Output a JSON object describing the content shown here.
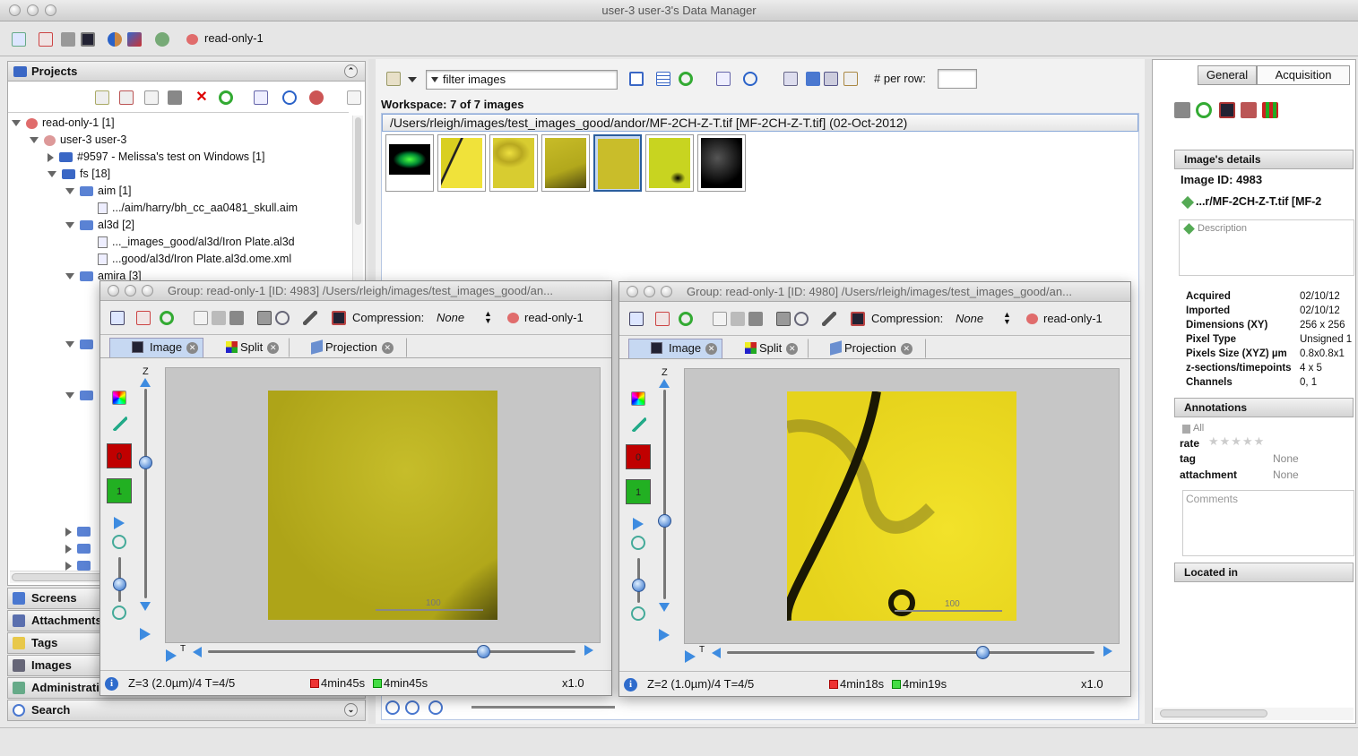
{
  "window": {
    "title": "user-3 user-3's Data Manager"
  },
  "toolbar": {
    "group_label": "read-only-1"
  },
  "projects": {
    "header": "Projects",
    "tree": [
      {
        "label": "read-only-1 [1]"
      },
      {
        "label": "user-3 user-3"
      },
      {
        "label": "#9597 - Melissa's test on Windows [1]"
      },
      {
        "label": "fs [18]"
      },
      {
        "label": "aim [1]"
      },
      {
        "label": ".../aim/harry/bh_cc_aa0481_skull.aim"
      },
      {
        "label": "al3d [2]"
      },
      {
        "label": "..._images_good/al3d/Iron Plate.al3d"
      },
      {
        "label": "...good/al3d/Iron Plate.al3d.ome.xml"
      },
      {
        "label": "amira [3]"
      }
    ]
  },
  "accordion": [
    "Screens",
    "Attachments",
    "Tags",
    "Images",
    "Administration",
    "Search"
  ],
  "center": {
    "filter_placeholder": "filter  images",
    "per_row_label": "# per row:",
    "workspace": "Workspace: 7 of 7 images",
    "path": "/Users/rleigh/images/test_images_good/andor/MF-2CH-Z-T.tif [MF-2CH-Z-T.tif] (02-Oct-2012)"
  },
  "viewer1": {
    "title": "Group: read-only-1 [ID: 4983] /Users/rleigh/images/test_images_good/an...",
    "compression_label": "Compression:",
    "compression_value": "None",
    "group": "read-only-1",
    "tabs": [
      "Image",
      "Split",
      "Projection"
    ],
    "z_label": "Z",
    "t_label": "T",
    "channels": [
      "0",
      "1"
    ],
    "status_z": "Z=3 (2.0µm)/4 T=4/5",
    "status_ch1": "4min45s",
    "status_ch2": "4min45s",
    "zoom": "x1.0",
    "scale": "100"
  },
  "viewer2": {
    "title": "Group: read-only-1 [ID: 4980] /Users/rleigh/images/test_images_good/an...",
    "compression_label": "Compression:",
    "compression_value": "None",
    "group": "read-only-1",
    "tabs": [
      "Image",
      "Split",
      "Projection"
    ],
    "z_label": "Z",
    "t_label": "T",
    "channels": [
      "0",
      "1"
    ],
    "status_z": "Z=2 (1.0µm)/4 T=4/5",
    "status_ch1": "4min18s",
    "status_ch2": "4min19s",
    "zoom": "x1.0",
    "scale": "100"
  },
  "right": {
    "tabs": [
      "General",
      "Acquisition"
    ],
    "details_header": "Image's details",
    "image_id": "Image ID: 4983",
    "name": "...r/MF-2CH-Z-T.tif [MF-2",
    "description_placeholder": "Description",
    "props": [
      {
        "k": "Acquired",
        "v": "02/10/12"
      },
      {
        "k": "Imported",
        "v": "02/10/12"
      },
      {
        "k": "Dimensions (XY)",
        "v": "256 x 256"
      },
      {
        "k": "Pixel Type",
        "v": "Unsigned 1"
      },
      {
        "k": "Pixels Size (XYZ) µm",
        "v": "0.8x0.8x1"
      },
      {
        "k": "z-sections/timepoints",
        "v": "4 x 5"
      },
      {
        "k": "Channels",
        "v": "0, 1"
      }
    ],
    "annotations_header": "Annotations",
    "all_label": "All",
    "rate_label": "rate",
    "tag_label": "tag",
    "tag_value": "None",
    "attachment_label": "attachment",
    "attachment_value": "None",
    "comments_placeholder": "Comments",
    "located_header": "Located in"
  },
  "colors": {
    "accent": "#3d8be0",
    "yellow": "#d4cc1c",
    "chan_red": "#c00000",
    "chan_green": "#22b022"
  }
}
